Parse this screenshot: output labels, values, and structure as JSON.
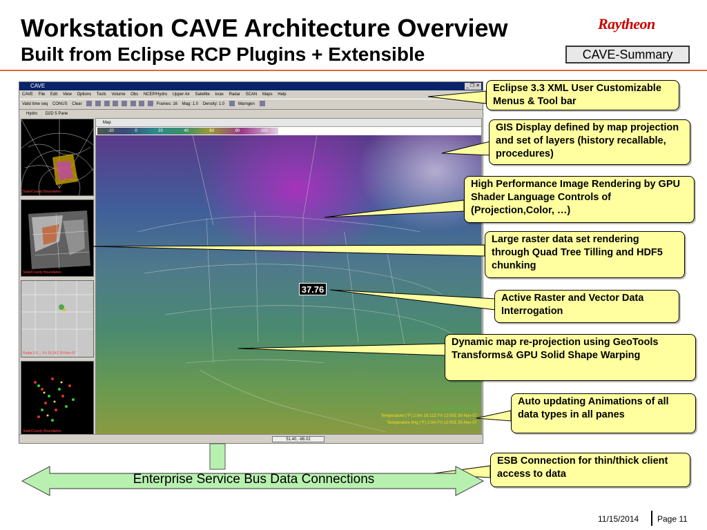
{
  "slide": {
    "title": "Workstation CAVE Architecture Overview",
    "subtitle": "Built from Eclipse RCP Plugins + Extensible",
    "logo_text": "Raytheon",
    "badge": "CAVE-Summary",
    "footer_date": "11/15/2014",
    "footer_page": "Page 11",
    "colors": {
      "rule": "#e26a2c",
      "callout_fill": "#ffffa0",
      "esb_arrow": "#b8f0b0",
      "logo": "#cc0000"
    }
  },
  "screenshot": {
    "window_title": "CAVE",
    "menu": [
      "CAVE",
      "File",
      "Edit",
      "View",
      "Options",
      "Tools",
      "Volume",
      "Obs",
      "NCEP/Hydro",
      "Upper Air",
      "Satellite",
      "kxax",
      "Radar",
      "SCAN",
      "Maps",
      "Help"
    ],
    "toolbar": {
      "time_select": "Valid time seq",
      "scale": "CONUS",
      "clear": "Clear",
      "frames": "Frames: 16",
      "mag": "Mag: 1.0",
      "density": "Density: 1.0",
      "warngen": "Warngen"
    },
    "pane_tabs": [
      "Hydro",
      "D2D 5 Pane"
    ],
    "thumbs": [
      {
        "caption": "State/County Boundaries"
      },
      {
        "caption": "State/County Boundaries"
      },
      {
        "caption": "Radar 0.5 ... Fri 16:14Z 30-Nov-07"
      },
      {
        "caption": "State/County Boundaries"
      }
    ],
    "map_tab": "Map",
    "colorbar_ticks": [
      "-20",
      "0",
      "20",
      "40",
      "60",
      "80",
      "100"
    ],
    "probe_value": "37.76",
    "legend": [
      "State/County Boundaries",
      "Temperature (°F) 2.0m 16:12Z Fri 12:00Z 30-Nov-07",
      "Temperature Img (°F) 2.0m Fri 12:00Z 30-Nov-07"
    ],
    "coords": "51.40, -86.02"
  },
  "callouts": [
    {
      "text": "Eclipse 3.3 XML User Customizable Menus & Tool bar"
    },
    {
      "text": "GIS Display defined by map projection and set of layers (history recallable, procedures)"
    },
    {
      "text": "High Performance Image Rendering by GPU Shader Language Controls of (Projection,Color, …)"
    },
    {
      "text": "Large raster data set rendering through Quad Tree Tilling and HDF5 chunking"
    },
    {
      "text": "Active Raster and Vector Data Interrogation"
    },
    {
      "text": "Dynamic map re-projection  using GeoTools Transforms&  GPU Solid Shape Warping"
    },
    {
      "text": "Auto updating Animations of all data types in all panes"
    },
    {
      "text": "ESB Connection for thin/thick client access to data"
    }
  ],
  "esb": {
    "label": "Enterprise Service Bus Data Connections"
  }
}
